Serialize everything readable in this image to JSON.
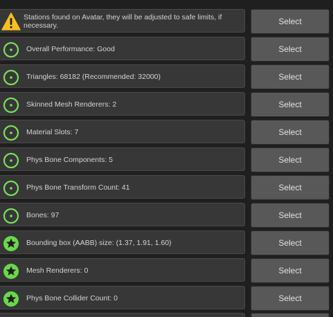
{
  "colors": {
    "background": "#1f1f1f",
    "row_background": "#373737",
    "button_background": "#585858",
    "good_ring": "#7be05a",
    "excellent_fill": "#6ad84a",
    "warning_fill": "#f5c01b"
  },
  "rows": [
    {
      "icon": "warning-icon",
      "message": "Stations found on Avatar, they will be adjusted to safe limits, if necessary.",
      "button": "Select"
    },
    {
      "icon": "good-rating-icon",
      "message": "Overall Performance: Good",
      "button": "Select"
    },
    {
      "icon": "good-rating-icon",
      "message": "Triangles: 68182 (Recommended: 32000)",
      "button": "Select"
    },
    {
      "icon": "good-rating-icon",
      "message": "Skinned Mesh Renderers: 2",
      "button": "Select"
    },
    {
      "icon": "good-rating-icon",
      "message": "Material Slots: 7",
      "button": "Select"
    },
    {
      "icon": "good-rating-icon",
      "message": "Phys Bone Components: 5",
      "button": "Select"
    },
    {
      "icon": "good-rating-icon",
      "message": "Phys Bone Transform Count: 41",
      "button": "Select"
    },
    {
      "icon": "good-rating-icon",
      "message": "Bones: 97",
      "button": "Select"
    },
    {
      "icon": "excellent-rating-icon",
      "message": "Bounding box (AABB) size: (1.37, 1.91, 1.60)",
      "button": "Select"
    },
    {
      "icon": "excellent-rating-icon",
      "message": "Mesh Renderers: 0",
      "button": "Select"
    },
    {
      "icon": "excellent-rating-icon",
      "message": "Phys Bone Collider Count: 0",
      "button": "Select"
    }
  ]
}
